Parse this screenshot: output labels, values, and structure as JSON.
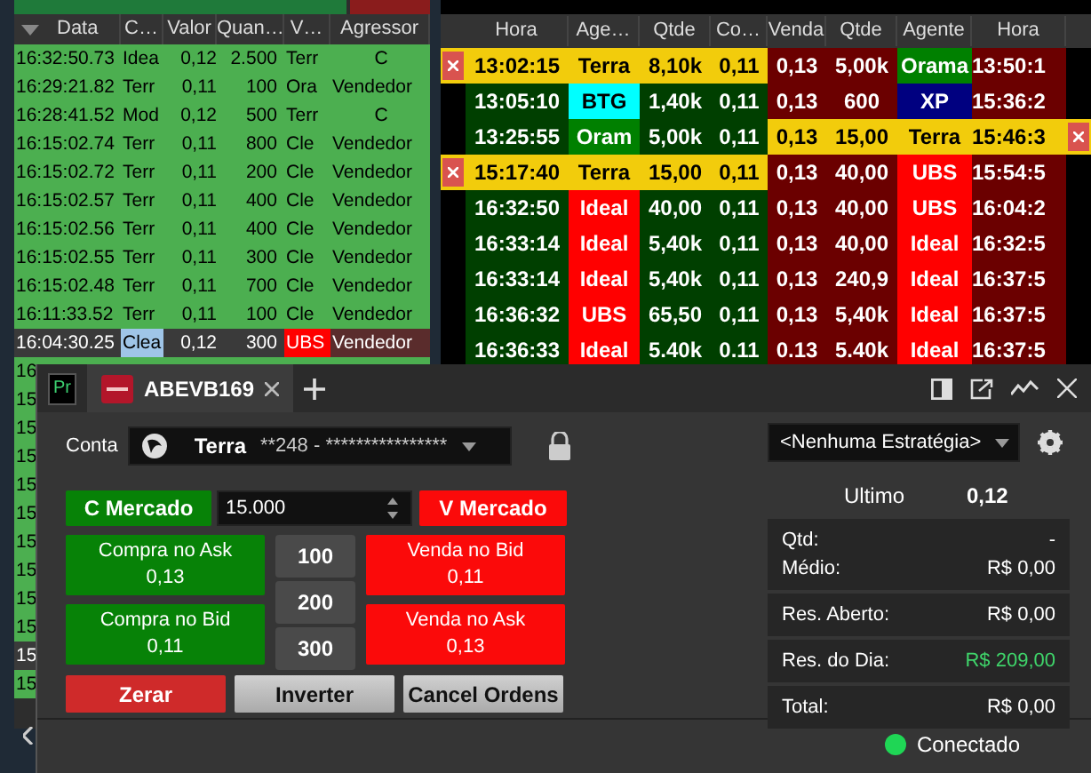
{
  "times_and_sales": {
    "columns": [
      "Data",
      "C…",
      "Valor",
      "Quan…",
      "V…",
      "Agressor"
    ],
    "rows": [
      {
        "kind": "trade",
        "cells": [
          "16:32:50.73",
          "Idea",
          "0,12",
          "2.500",
          "Terr",
          "C"
        ]
      },
      {
        "kind": "trade",
        "cells": [
          "16:29:21.82",
          "Terr",
          "0,11",
          "100",
          "Ora",
          "Vendedor"
        ]
      },
      {
        "kind": "trade",
        "cells": [
          "16:28:41.52",
          "Mod",
          "0,12",
          "500",
          "Terr",
          "C"
        ]
      },
      {
        "kind": "trade",
        "cells": [
          "16:15:02.74",
          "Terr",
          "0,11",
          "800",
          "Cle",
          "Vendedor"
        ]
      },
      {
        "kind": "trade",
        "cells": [
          "16:15:02.72",
          "Terr",
          "0,11",
          "200",
          "Cle",
          "Vendedor"
        ]
      },
      {
        "kind": "trade",
        "cells": [
          "16:15:02.57",
          "Terr",
          "0,11",
          "400",
          "Cle",
          "Vendedor"
        ]
      },
      {
        "kind": "trade",
        "cells": [
          "16:15:02.56",
          "Terr",
          "0,11",
          "400",
          "Cle",
          "Vendedor"
        ]
      },
      {
        "kind": "trade",
        "cells": [
          "16:15:02.55",
          "Terr",
          "0,11",
          "300",
          "Cle",
          "Vendedor"
        ]
      },
      {
        "kind": "trade",
        "cells": [
          "16:15:02.48",
          "Terr",
          "0,11",
          "700",
          "Cle",
          "Vendedor"
        ]
      },
      {
        "kind": "trade",
        "cells": [
          "16:11:33.52",
          "Terr",
          "0,11",
          "100",
          "Cle",
          "Vendedor"
        ]
      },
      {
        "kind": "selected",
        "cells": [
          "16:04:30.25",
          {
            "text": "Clea",
            "color": "#9fc5e8"
          },
          "0,12",
          "300",
          {
            "text": "UBS",
            "color": "#ff0000"
          },
          {
            "text": "Vendedor",
            "color": "#5a2c2c"
          }
        ]
      },
      {
        "kind": "trade",
        "cells": [
          "16"
        ]
      },
      {
        "kind": "trade",
        "cells": [
          "15"
        ]
      },
      {
        "kind": "trade",
        "cells": [
          "15"
        ]
      },
      {
        "kind": "trade",
        "cells": [
          "15"
        ]
      },
      {
        "kind": "trade",
        "cells": [
          "15"
        ]
      },
      {
        "kind": "trade",
        "cells": [
          "15"
        ]
      },
      {
        "kind": "trade",
        "cells": [
          "15"
        ]
      },
      {
        "kind": "trade",
        "cells": [
          "15"
        ]
      },
      {
        "kind": "trade",
        "cells": [
          "15"
        ]
      },
      {
        "kind": "trade",
        "cells": [
          "15"
        ]
      },
      {
        "kind": "selected",
        "cells": [
          "15"
        ]
      },
      {
        "kind": "trade",
        "cells": [
          "15"
        ]
      }
    ]
  },
  "book": {
    "columns": [
      "Hora",
      "Age…",
      "Qtde",
      "Co…",
      "Venda",
      "Qtde",
      "Agente",
      "Hora"
    ],
    "rows": [
      {
        "buy": {
          "own_order": true,
          "hora": "13:02:15",
          "agent": {
            "name": "Terra"
          },
          "qtde": "8,10k",
          "price": "0,11"
        },
        "sell": {
          "own_order": false,
          "price": "0,13",
          "qtde": "5,00k",
          "agent": {
            "name": "Orama",
            "color": "#008000"
          },
          "hora": "13:50:1"
        }
      },
      {
        "buy": {
          "own_order": false,
          "hora": "13:05:10",
          "agent": {
            "name": "BTG",
            "color": "#00ffff"
          },
          "qtde": "1,40k",
          "price": "0,11"
        },
        "sell": {
          "own_order": false,
          "price": "0,13",
          "qtde": "600",
          "agent": {
            "name": "XP",
            "color": "#000080"
          },
          "hora": "15:36:2"
        }
      },
      {
        "buy": {
          "own_order": false,
          "hora": "13:25:55",
          "agent": {
            "name": "Oram",
            "color": "#008000"
          },
          "qtde": "5,00k",
          "price": "0,11"
        },
        "sell": {
          "own_order": true,
          "price": "0,13",
          "qtde": "15,00",
          "agent": {
            "name": "Terra"
          },
          "hora": "15:46:3"
        }
      },
      {
        "buy": {
          "own_order": true,
          "hora": "15:17:40",
          "agent": {
            "name": "Terra"
          },
          "qtde": "15,00",
          "price": "0,11"
        },
        "sell": {
          "own_order": false,
          "price": "0,13",
          "qtde": "40,00",
          "agent": {
            "name": "UBS",
            "color": "#ff0000"
          },
          "hora": "15:54:5"
        }
      },
      {
        "buy": {
          "own_order": false,
          "hora": "16:32:50",
          "agent": {
            "name": "Ideal",
            "color": "#ff0000"
          },
          "qtde": "40,00",
          "price": "0,11"
        },
        "sell": {
          "own_order": false,
          "price": "0,13",
          "qtde": "40,00",
          "agent": {
            "name": "UBS",
            "color": "#ff0000"
          },
          "hora": "16:04:2"
        }
      },
      {
        "buy": {
          "own_order": false,
          "hora": "16:33:14",
          "agent": {
            "name": "Ideal",
            "color": "#ff0000"
          },
          "qtde": "5,40k",
          "price": "0,11"
        },
        "sell": {
          "own_order": false,
          "price": "0,13",
          "qtde": "40,00",
          "agent": {
            "name": "Ideal",
            "color": "#ff0000"
          },
          "hora": "16:32:5"
        }
      },
      {
        "buy": {
          "own_order": false,
          "hora": "16:33:14",
          "agent": {
            "name": "Ideal",
            "color": "#ff0000"
          },
          "qtde": "5,40k",
          "price": "0,11"
        },
        "sell": {
          "own_order": false,
          "price": "0,13",
          "qtde": "240,9",
          "agent": {
            "name": "Ideal",
            "color": "#ff0000"
          },
          "hora": "16:37:5"
        }
      },
      {
        "buy": {
          "own_order": false,
          "hora": "16:36:32",
          "agent": {
            "name": "UBS",
            "color": "#ff0000"
          },
          "qtde": "65,50",
          "price": "0,11"
        },
        "sell": {
          "own_order": false,
          "price": "0,13",
          "qtde": "5,40k",
          "agent": {
            "name": "Ideal",
            "color": "#ff0000"
          },
          "hora": "16:37:5"
        }
      },
      {
        "buy": {
          "own_order": false,
          "hora": "16:36:33",
          "agent": {
            "name": "Ideal",
            "color": "#ff0000"
          },
          "qtde": "5.40k",
          "price": "0.11"
        },
        "sell": {
          "own_order": false,
          "price": "0.13",
          "qtde": "5.40k",
          "agent": {
            "name": "Ideal",
            "color": "#ff0000"
          },
          "hora": "16:37:5"
        }
      }
    ]
  },
  "order_window": {
    "badge": "Pr",
    "tab": {
      "label": "ABEVB169",
      "selected": true
    },
    "account": {
      "label": "Conta",
      "broker": "Terra",
      "number": "**248 - ****************"
    },
    "strategy": {
      "value": "<Nenhuma Estratégia>"
    },
    "market_buy": "C Mercado",
    "quantity": "15.000",
    "market_sell": "V Mercado",
    "buy_buttons": [
      {
        "label": "Compra no Ask",
        "price": "0,13"
      },
      {
        "label": "Compra no Bid",
        "price": "0,11"
      }
    ],
    "quantity_presets": [
      "100",
      "200",
      "300"
    ],
    "sell_buttons": [
      {
        "label": "Venda no Bid",
        "price": "0,11"
      },
      {
        "label": "Venda no Ask",
        "price": "0,13"
      }
    ],
    "actions": [
      {
        "kind": "danger",
        "label": "Zerar"
      },
      {
        "kind": "neutral",
        "label": "Inverter"
      },
      {
        "kind": "neutral",
        "label": "Cancel Ordens"
      }
    ],
    "last": {
      "label": "Ultimo",
      "value": "0,12"
    },
    "position": [
      [
        {
          "label": "Qtd:",
          "value": "-",
          "positive": false
        },
        {
          "label": "Médio:",
          "value": "R$ 0,00",
          "positive": false
        }
      ],
      [
        {
          "label": "Res. Aberto:",
          "value": "R$ 0,00",
          "positive": false
        }
      ],
      [
        {
          "label": "Res. do Dia:",
          "value": "R$ 209,00",
          "positive": true
        }
      ],
      [
        {
          "label": "Total:",
          "value": "R$ 0,00",
          "positive": false
        }
      ]
    ],
    "status": {
      "label": "Conectado",
      "connected": true
    }
  }
}
